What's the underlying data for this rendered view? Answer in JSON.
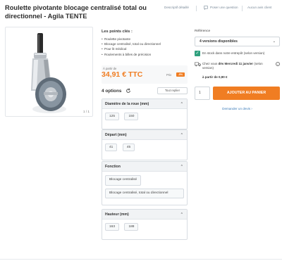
{
  "product": {
    "title": "Roulette pivotante blocage centralisé total ou directionnel - Agila TENTE"
  },
  "top_links": [
    {
      "label": "Descriptif détaillé"
    },
    {
      "label": "Poser une question"
    },
    {
      "label": "Aucun avis client"
    }
  ],
  "image": {
    "counter": "1 / 1"
  },
  "key_points": {
    "heading": "Les points clés :",
    "items": [
      "Roulette pivotante",
      "Blocage centralisé, total ou directionnel",
      "Pour lit médical",
      "Roulements à billes de précision"
    ]
  },
  "price": {
    "from_label": "À partir de",
    "value": "34,91 € TTC",
    "prix_label": "Prix",
    "badge": "-5%"
  },
  "options": {
    "count_label": "4 options",
    "reset_icon": "refresh-icon",
    "show_all_label": "Tout replier",
    "groups": [
      {
        "title": "Diamètre de la roue (mm)",
        "values": [
          "125",
          "150"
        ]
      },
      {
        "title": "Départ (mm)",
        "values": [
          "41",
          "45"
        ]
      },
      {
        "title": "Fonction",
        "values": [
          "Blocage centralisé",
          "Blocage centralisé, total ou directionnel"
        ]
      },
      {
        "title": "Hauteur (mm)",
        "values": [
          "163",
          "188"
        ]
      }
    ]
  },
  "purchase": {
    "reference_label": "Référence",
    "versions_label": "4 versions disponibles",
    "stock_text": "En stock dans notre entrepôt (selon version)",
    "delivery_prefix": "Chez vous",
    "delivery_date": "dès Mercredi 11 janvier",
    "delivery_suffix": "(selon version)",
    "delivery_price": "à partir de 0,90 €",
    "quantity": "1",
    "add_to_cart": "AJOUTER AU PANIER",
    "quote_link": "Demander un devis"
  },
  "colors": {
    "accent": "#f07d22",
    "stock_green": "#2fa07e",
    "link_blue": "#3a7ab8"
  }
}
